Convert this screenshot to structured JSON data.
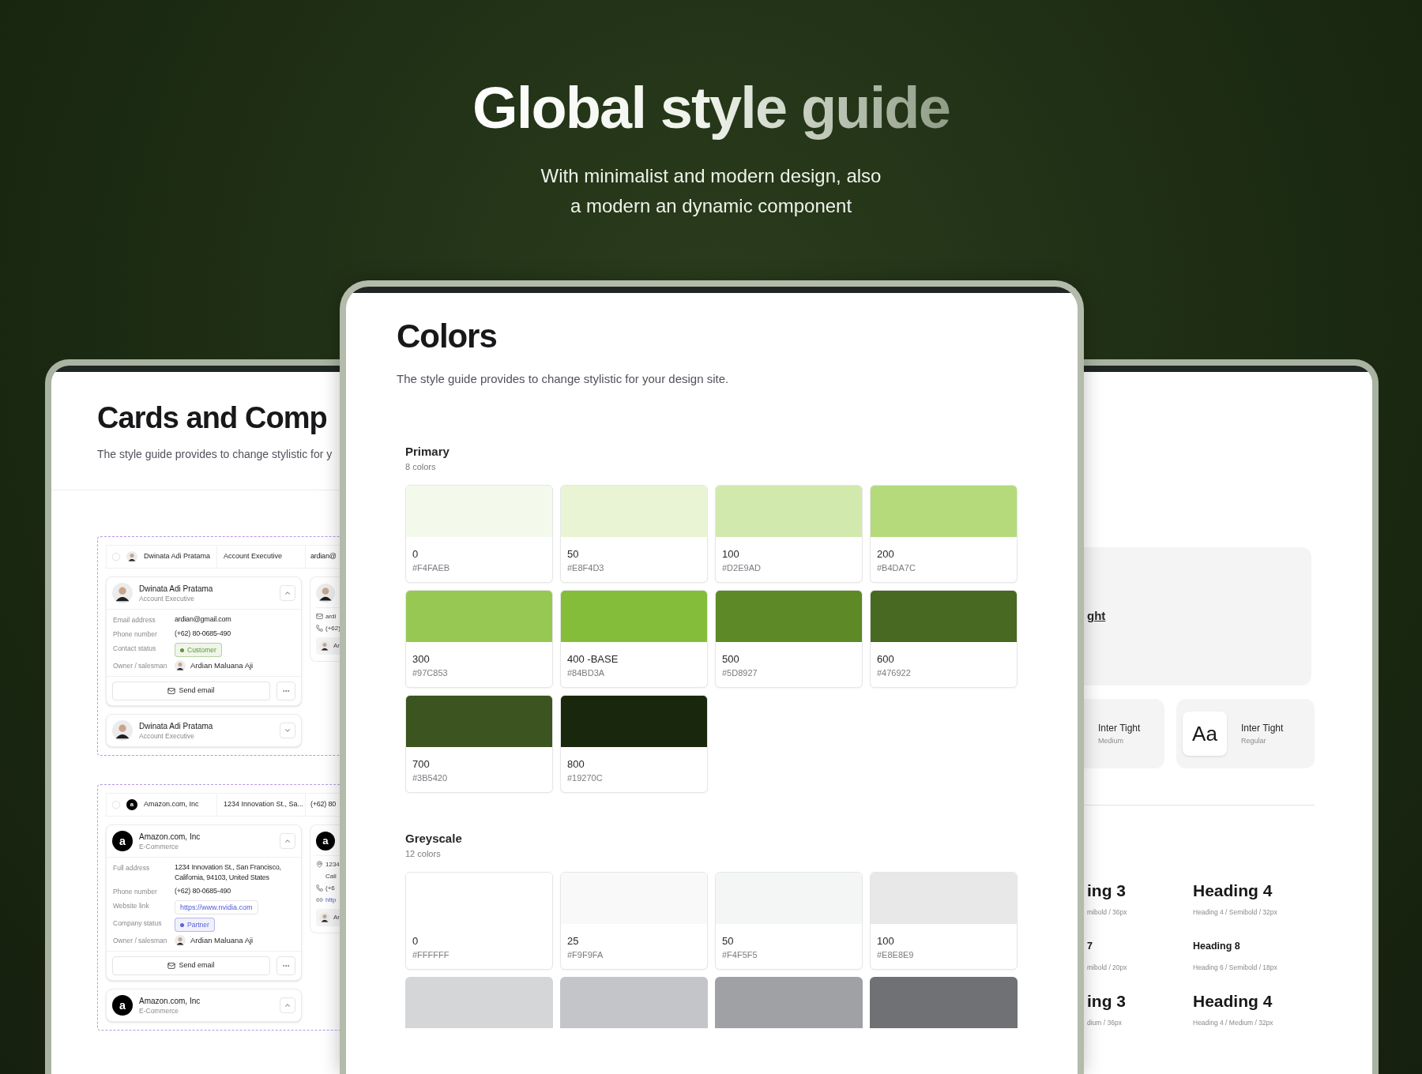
{
  "hero": {
    "title": "Global style guide",
    "subtitle_lines": [
      "With minimalist and modern design, also",
      "a modern an dynamic component"
    ]
  },
  "left_screen": {
    "title": "Cards and Comp",
    "subtitle": "The style guide provides to change stylistic for y",
    "groups": [
      {
        "table_row": {
          "checked": false,
          "cells": [
            "Dwinata Adi Pratama",
            "Account Executive",
            "ardian@"
          ]
        },
        "cards": [
          {
            "title": "Dwinata Adi Pratama",
            "subtitle": "Account Executive",
            "expanded": true,
            "fields": [
              {
                "kind": "text",
                "label": "Email address",
                "value": "ardian@gmail.com"
              },
              {
                "kind": "text",
                "label": "Phone number",
                "value": "(+62) 80-0685-490"
              },
              {
                "kind": "badge",
                "label": "Contact status",
                "value": "Customer",
                "color": "#5d9a2f"
              },
              {
                "kind": "person",
                "label": "Owner / salesman",
                "value": "Ardian Maluana Aji"
              }
            ],
            "primary_action": "Send email"
          },
          {
            "title": "Dwinata Adi Pratama",
            "subtitle": "Account Executive",
            "expanded": false
          }
        ],
        "side_card": {
          "lines": [
            {
              "kind": "mail",
              "text": "ardi"
            },
            {
              "kind": "phone",
              "text": "(+62)"
            }
          ],
          "owner": "Ar"
        }
      },
      {
        "table_row": {
          "checked": false,
          "logo_letter": "a",
          "cells": [
            "Amazon.com, Inc",
            "1234 Innovation St., Sa...",
            "(+62) 80"
          ]
        },
        "cards": [
          {
            "logo_letter": "a",
            "title": "Amazon.com, Inc",
            "subtitle": "E-Commerce",
            "expanded": true,
            "fields": [
              {
                "kind": "text",
                "label": "Full address",
                "value": "1234 Innovation St., San Francisco, California, 94103, United States"
              },
              {
                "kind": "text",
                "label": "Phone number",
                "value": "(+62) 80-0685-490"
              },
              {
                "kind": "link",
                "label": "Website link",
                "value": "https://www.nvidia.com"
              },
              {
                "kind": "badge",
                "label": "Company status",
                "value": "Partner",
                "color": "#5b63d6"
              },
              {
                "kind": "person",
                "label": "Owner / salesman",
                "value": "Ardian Maluana Aji"
              }
            ],
            "primary_action": "Send email"
          },
          {
            "logo_letter": "a",
            "title": "Amazon.com, Inc",
            "subtitle": "E-Commerce",
            "expanded": true
          }
        ],
        "side_card": {
          "logo_letter": "a",
          "lines": [
            {
              "kind": "pin",
              "text": "1234"
            },
            {
              "kind": "continuation",
              "text": "Cali"
            },
            {
              "kind": "phone",
              "text": "(+6"
            },
            {
              "kind": "link",
              "text": "http"
            }
          ],
          "owner": "Ar"
        }
      }
    ]
  },
  "colors_screen": {
    "title": "Colors",
    "subtitle": "The style guide provides to change stylistic for your design site.",
    "sections": [
      {
        "title": "Primary",
        "count": "8 colors",
        "swatches": [
          {
            "name": "0",
            "hex": "#F4FAEB",
            "color": "#f4faeb"
          },
          {
            "name": "50",
            "hex": "#E8F4D3",
            "color": "#e8f4d3"
          },
          {
            "name": "100",
            "hex": "#D2E9AD",
            "color": "#d2e9ad"
          },
          {
            "name": "200",
            "hex": "#B4DA7C",
            "color": "#b4da7c"
          },
          {
            "name": "300",
            "hex": "#97C853",
            "color": "#97c853"
          },
          {
            "name": "400 -BASE",
            "hex": "#84BD3A",
            "color": "#84bd3a"
          },
          {
            "name": "500",
            "hex": "#5D8927",
            "color": "#5d8927"
          },
          {
            "name": "600",
            "hex": "#476922",
            "color": "#476922"
          },
          {
            "name": "700",
            "hex": "#3B5420",
            "color": "#3b5420"
          },
          {
            "name": "800",
            "hex": "#19270C",
            "color": "#19270c"
          }
        ]
      },
      {
        "title": "Greyscale",
        "count": "12 colors",
        "swatches": [
          {
            "name": "0",
            "hex": "#FFFFFF",
            "color": "#ffffff"
          },
          {
            "name": "25",
            "hex": "#F9F9FA",
            "color": "#f9f9fa"
          },
          {
            "name": "50",
            "hex": "#F4F5F5",
            "color": "#f4f5f5"
          },
          {
            "name": "100",
            "hex": "#E8E8E9",
            "color": "#e8e8e9"
          },
          {
            "color": "#d4d6d7"
          },
          {
            "color": "#c4c5c8"
          },
          {
            "color": "#a0a1a4"
          },
          {
            "color": "#6f7175"
          }
        ]
      }
    ]
  },
  "type_screen": {
    "preview_text": "ght",
    "font_cards": [
      {
        "family": "Inter Tight",
        "weight": "Medium"
      },
      {
        "sample": "Aa",
        "family": "Inter Tight",
        "weight": "Regular"
      }
    ],
    "heading_rows": [
      {
        "kind": "large",
        "left": {
          "title": "ing 3",
          "meta": "mibold / 36px"
        },
        "right": {
          "title": "Heading 4",
          "meta": "Heading 4 / Semibold / 32px"
        }
      },
      {
        "kind": "small",
        "left": {
          "title": "7",
          "meta": "mibold / 20px"
        },
        "right": {
          "title": "Heading 8",
          "meta": "Heading 6 / Semibold / 18px"
        }
      },
      {
        "kind": "large",
        "left": {
          "title": "ing 3",
          "meta": "dium / 36px"
        },
        "right": {
          "title": "Heading 4",
          "meta": "Heading 4 / Medium / 32px"
        }
      }
    ]
  }
}
